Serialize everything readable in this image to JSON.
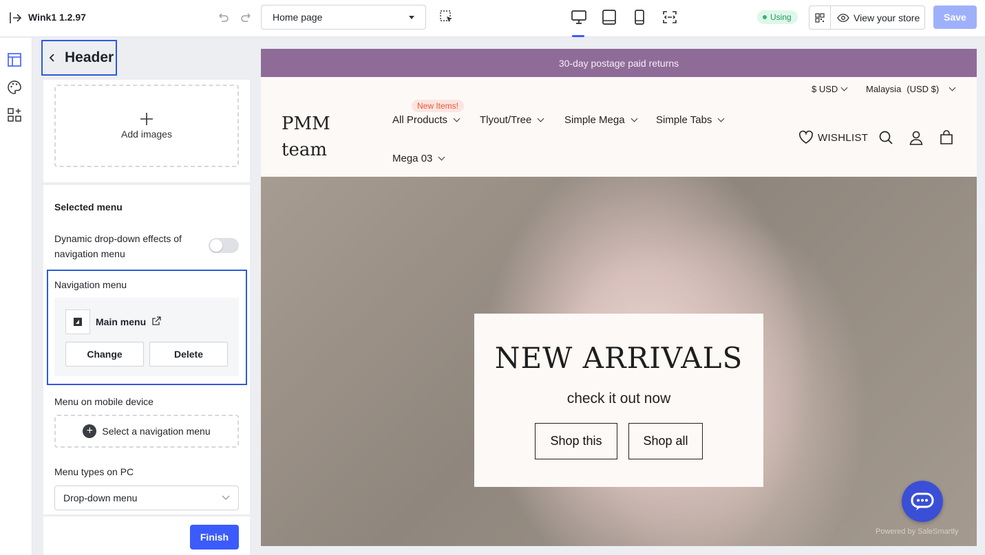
{
  "topbar": {
    "app_title": "Wink1 1.2.97",
    "page_select": "Home page",
    "status": "Using",
    "view_store": "View your store",
    "save": "Save",
    "devices": [
      "desktop-icon",
      "tablet-icon",
      "mobile-icon",
      "fullscreen-icon"
    ]
  },
  "rail": {
    "items": [
      "layout-icon",
      "palette-icon",
      "apps-add-icon"
    ]
  },
  "panel": {
    "title": "Header",
    "add_images": "Add images",
    "selected_menu": "Selected menu",
    "dynamic_label": "Dynamic drop-down effects of navigation menu",
    "dynamic_enabled": false,
    "navigation_menu": "Navigation menu",
    "menu_name": "Main menu",
    "change": "Change",
    "delete": "Delete",
    "mobile_menu_label": "Menu on mobile device",
    "select_nav": "Select a navigation menu",
    "menu_types_label": "Menu types on PC",
    "menu_type_value": "Drop-down menu",
    "finish": "Finish"
  },
  "store": {
    "announcement": "30-day postage paid returns",
    "currency": "$ USD",
    "country": "Malaysia",
    "country_currency": "(USD $)",
    "logo_line1": "PMM",
    "logo_line2": "team",
    "badge": "New Items!",
    "nav": [
      "All Products",
      "Tlyout/Tree",
      "Simple Mega",
      "Simple Tabs",
      "Mega 03"
    ],
    "wishlist": "WISHLIST",
    "hero_title": "NEW ARRIVALS",
    "hero_subtitle": "check it out now",
    "shop_this": "Shop this",
    "shop_all": "Shop all",
    "powered_by": "Powered by SaleSmartly"
  },
  "colors": {
    "accent": "#3b5bfd",
    "announcement_bg": "#8f6c98",
    "highlight_border": "#2d5bd8"
  }
}
